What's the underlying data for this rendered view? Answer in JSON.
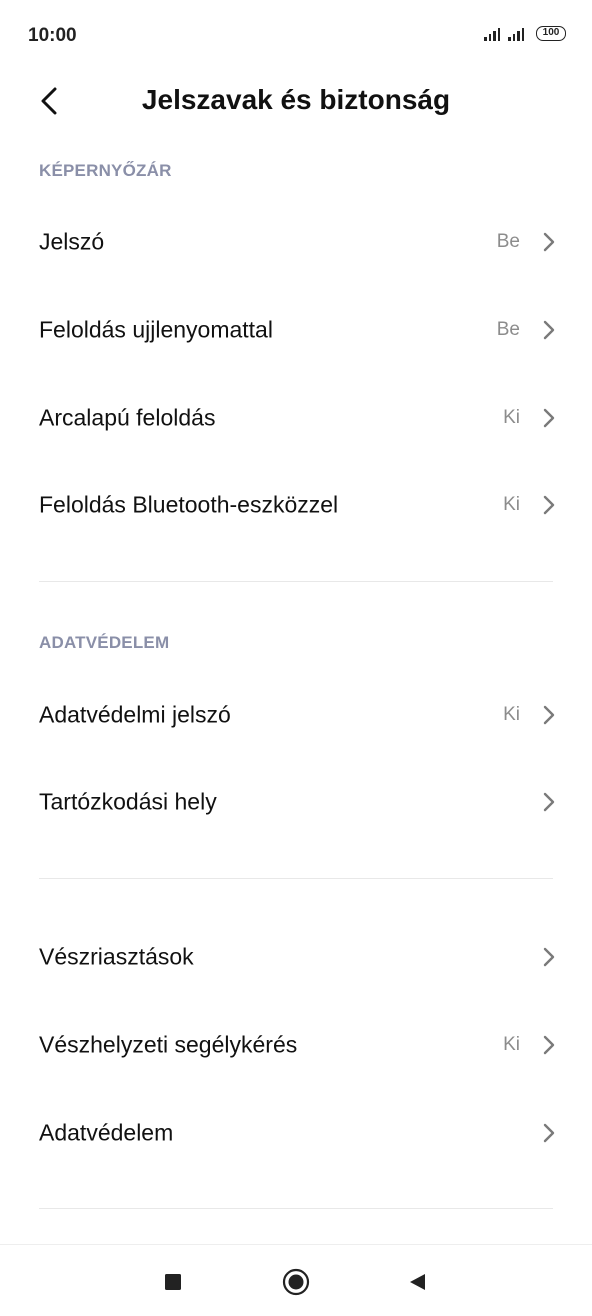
{
  "status_bar": {
    "time": "10:00",
    "battery": "100",
    "icons": [
      "signal-icon",
      "signal-icon",
      "battery-icon"
    ]
  },
  "header": {
    "title": "Jelszavak és biztonság",
    "back_icon": "back-chevron-icon"
  },
  "sections": {
    "lock_screen": {
      "title": "KÉPERNYŐZÁR",
      "items": [
        {
          "label": "Jelszó",
          "value": "Be"
        },
        {
          "label": "Feloldás ujjlenyomattal",
          "value": "Be"
        },
        {
          "label": "Arcalapú feloldás",
          "value": "Ki"
        },
        {
          "label": "Feloldás Bluetooth-eszközzel",
          "value": "Ki"
        }
      ]
    },
    "privacy": {
      "title": "ADATVÉDELEM",
      "items": [
        {
          "label": "Adatvédelmi jelszó",
          "value": "Ki"
        },
        {
          "label": "Tartózkodási hely",
          "value": ""
        }
      ]
    },
    "emergency": {
      "items": [
        {
          "label": "Vészriasztások",
          "value": ""
        },
        {
          "label": "Vészhelyzeti segélykérés",
          "value": "Ki"
        },
        {
          "label": "Adatvédelem",
          "value": ""
        }
      ]
    }
  },
  "nav_bar": {
    "icons": [
      "recents-square-icon",
      "home-circle-icon",
      "back-triangle-icon"
    ]
  },
  "colors": {
    "section_header": "#8a8fa8",
    "value_text": "#8c8c8c",
    "divider": "#e8e8e8"
  }
}
